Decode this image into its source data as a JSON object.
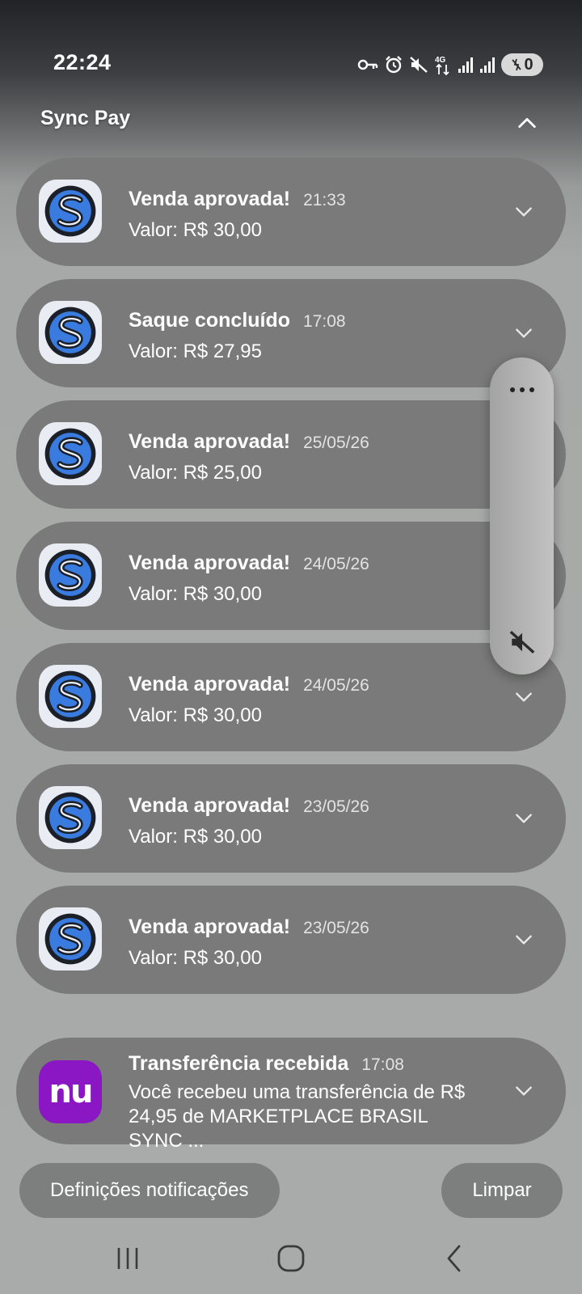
{
  "status_bar": {
    "time": "22:24",
    "network": "4G",
    "battery_label": "0",
    "icons": [
      "vpn-key-icon",
      "alarm-icon",
      "mute-icon",
      "network-4g-icon",
      "signal-icon",
      "signal-icon",
      "battery-icon"
    ]
  },
  "group": {
    "title": "Sync Pay",
    "collapse_icon": "chevron-up-icon"
  },
  "notifications": [
    {
      "app": "Sync Pay",
      "title": "Venda aprovada!",
      "time": "21:33",
      "text": "Valor: R$ 30,00"
    },
    {
      "app": "Sync Pay",
      "title": "Saque concluído",
      "time": "17:08",
      "text": "Valor: R$ 27,95"
    },
    {
      "app": "Sync Pay",
      "title": "Venda aprovada!",
      "time": "25/05/26",
      "text": "Valor: R$ 25,00"
    },
    {
      "app": "Sync Pay",
      "title": "Venda aprovada!",
      "time": "24/05/26",
      "text": "Valor: R$ 30,00"
    },
    {
      "app": "Sync Pay",
      "title": "Venda aprovada!",
      "time": "24/05/26",
      "text": "Valor: R$ 30,00"
    },
    {
      "app": "Sync Pay",
      "title": "Venda aprovada!",
      "time": "23/05/26",
      "text": "Valor: R$ 30,00"
    },
    {
      "app": "Sync Pay",
      "title": "Venda aprovada!",
      "time": "23/05/26",
      "text": "Valor: R$ 30,00"
    }
  ],
  "nu_notification": {
    "app": "Nubank",
    "icon_text": "nu",
    "title": "Transferência recebida",
    "time": "17:08",
    "text": "Você recebeu uma transferência de R$ 24,95 de MARKETPLACE BRASIL SYNC ..."
  },
  "side_panel": {
    "more_icon": "more-horizontal-icon",
    "mute_icon": "mute-icon"
  },
  "buttons": {
    "settings": "Definições notificações",
    "clear": "Limpar"
  },
  "nav_bar": {
    "icons": [
      "recent-apps-icon",
      "home-icon",
      "back-icon"
    ]
  },
  "colors": {
    "card_bg": "#797a79",
    "sync_blue": "#3a7be0",
    "nu_purple": "#8a16c4"
  }
}
